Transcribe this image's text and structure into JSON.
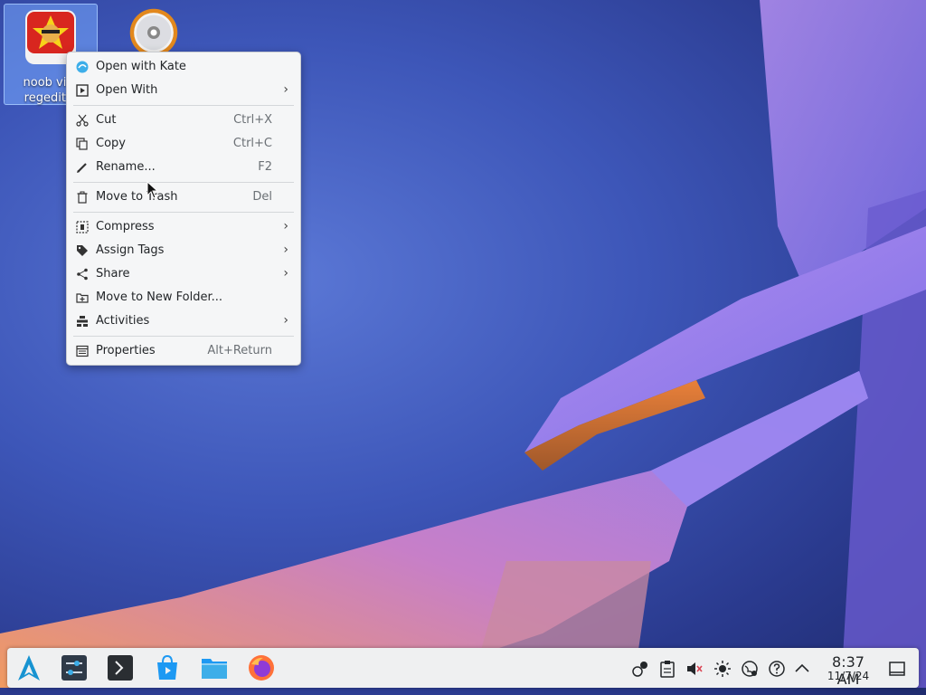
{
  "desktop": {
    "icons": [
      {
        "label": "noob viet\nregedit b",
        "icon": "red-app-icon"
      },
      {
        "label": "",
        "icon": "disc-icon"
      }
    ]
  },
  "context_menu": {
    "items": [
      {
        "label": "Open with Kate",
        "icon": "kate-icon",
        "shortcut": "",
        "submenu": false
      },
      {
        "label": "Open With",
        "icon": "open-with-icon",
        "shortcut": "",
        "submenu": true
      },
      {
        "label": "Cut",
        "icon": "scissors-icon",
        "shortcut": "Ctrl+X",
        "submenu": false
      },
      {
        "label": "Copy",
        "icon": "copy-icon",
        "shortcut": "Ctrl+C",
        "submenu": false
      },
      {
        "label": "Rename...",
        "icon": "pencil-icon",
        "shortcut": "F2",
        "submenu": false
      },
      {
        "label": "Move to Trash",
        "icon": "trash-icon",
        "shortcut": "Del",
        "submenu": false
      },
      {
        "label": "Compress",
        "icon": "compress-icon",
        "shortcut": "",
        "submenu": true
      },
      {
        "label": "Assign Tags",
        "icon": "tag-icon",
        "shortcut": "",
        "submenu": true
      },
      {
        "label": "Share",
        "icon": "share-icon",
        "shortcut": "",
        "submenu": true
      },
      {
        "label": "Move to New Folder...",
        "icon": "new-folder-icon",
        "shortcut": "",
        "submenu": false
      },
      {
        "label": "Activities",
        "icon": "activities-icon",
        "shortcut": "",
        "submenu": true
      },
      {
        "label": "Properties",
        "icon": "properties-icon",
        "shortcut": "Alt+Return",
        "submenu": false
      }
    ],
    "submenu_arrow": "›"
  },
  "taskbar": {
    "apps": [
      "launcher-icon",
      "settings-icon",
      "terminal-icon",
      "discover-icon",
      "files-icon",
      "firefox-icon"
    ],
    "tray": [
      "updates-icon",
      "clipboard-icon",
      "volume-muted-icon",
      "brightness-icon",
      "network-icon",
      "help-icon",
      "tray-expand-icon"
    ],
    "clock": {
      "time": "8:37 AM",
      "date": "11/7/24"
    }
  },
  "colors": {
    "accent": "#3daee9",
    "panel": "#eff0f1",
    "menu_bg": "#f5f6f7"
  }
}
